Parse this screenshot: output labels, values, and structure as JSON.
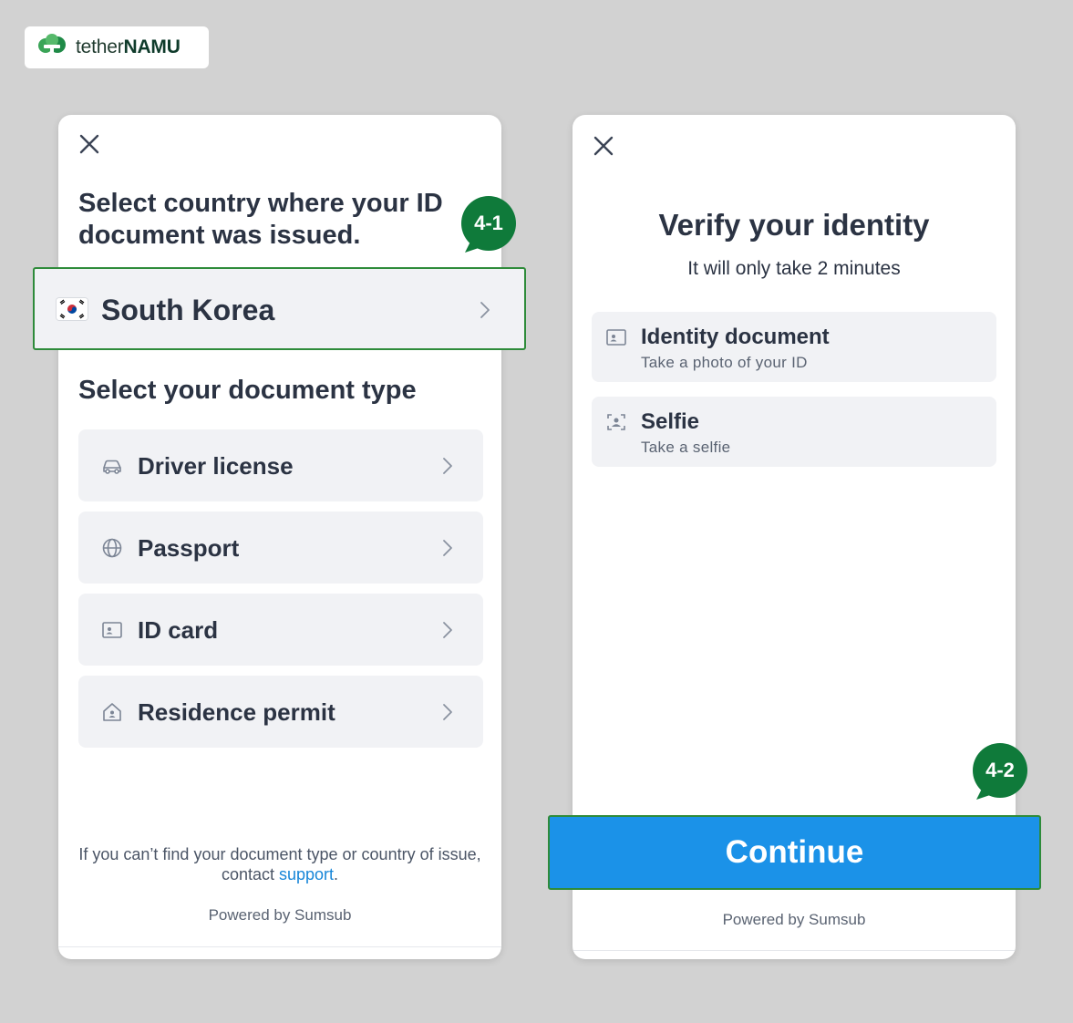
{
  "brand": {
    "name_light": "tether",
    "name_bold": "NAMU"
  },
  "colors": {
    "accent_green": "#0f7a3a",
    "primary_blue": "#1b92e8",
    "link_blue": "#1786d8"
  },
  "left_screen": {
    "close_icon": "close-icon",
    "title": "Select country where your ID document was issued.",
    "country": {
      "flag_icon": "south-korea-flag-icon",
      "label": "South Korea"
    },
    "doc_section_title": "Select your document type",
    "doc_types": [
      {
        "icon": "car-icon",
        "label": "Driver license"
      },
      {
        "icon": "globe-icon",
        "label": "Passport"
      },
      {
        "icon": "id-card-icon",
        "label": "ID card"
      },
      {
        "icon": "house-icon",
        "label": "Residence permit"
      }
    ],
    "footnote_text": "If you can’t find your document type or country of issue, contact",
    "footnote_link": "support",
    "footnote_end": ".",
    "powered": "Powered by Sumsub"
  },
  "right_screen": {
    "close_icon": "close-icon",
    "title": "Verify your identity",
    "subtitle": "It will only take 2 minutes",
    "steps": [
      {
        "icon": "id-card-icon",
        "title": "Identity document",
        "subtitle": "Take a photo of your ID"
      },
      {
        "icon": "selfie-icon",
        "title": "Selfie",
        "subtitle": "Take a selfie"
      }
    ],
    "continue_label": "Continue",
    "powered": "Powered by Sumsub"
  },
  "annotations": {
    "badge_1": "4-1",
    "badge_2": "4-2"
  }
}
